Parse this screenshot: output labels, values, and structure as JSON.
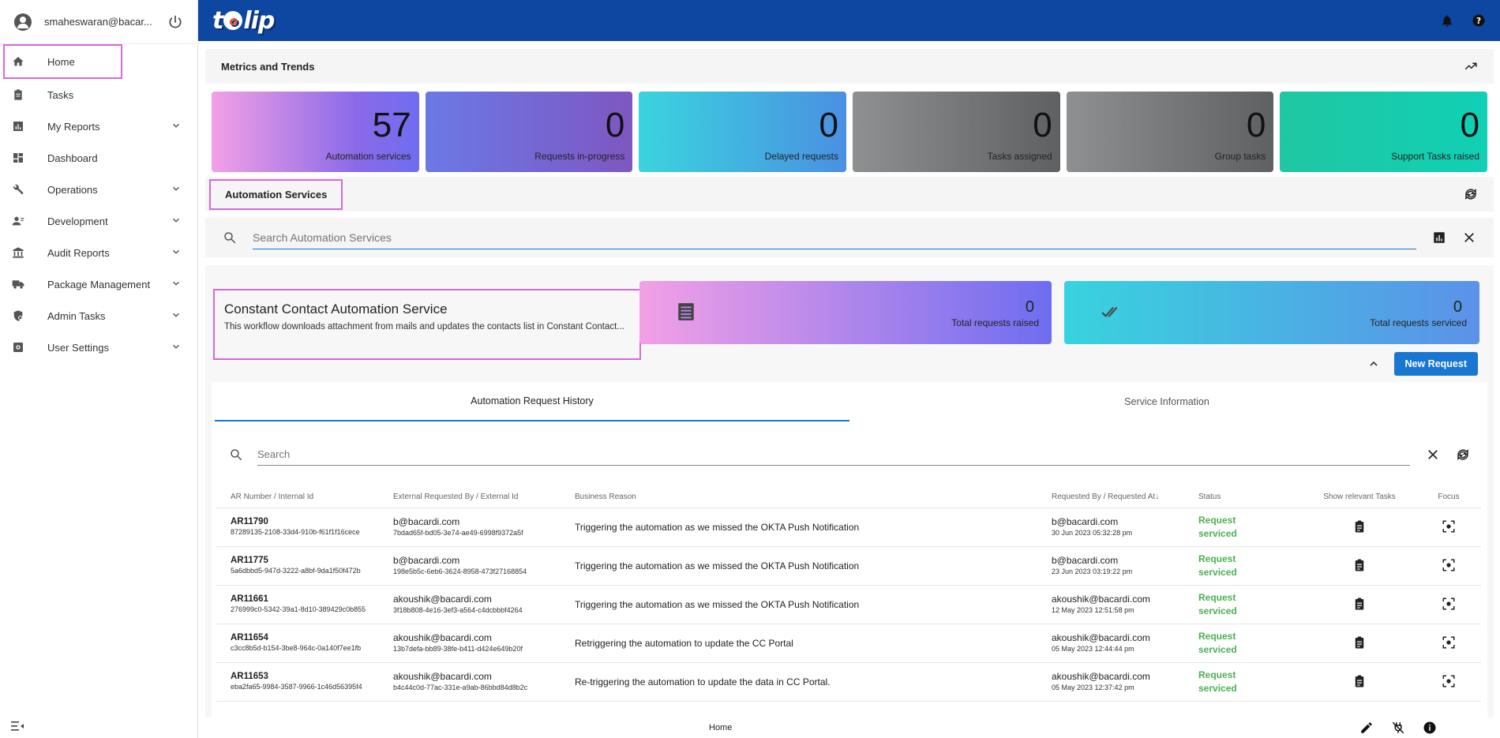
{
  "user": {
    "email": "smaheswaran@bacar..."
  },
  "nav": [
    {
      "label": "Home",
      "icon": "home-icon",
      "expandable": false
    },
    {
      "label": "Tasks",
      "icon": "clipboard-icon",
      "expandable": false
    },
    {
      "label": "My Reports",
      "icon": "report-icon",
      "expandable": true
    },
    {
      "label": "Dashboard",
      "icon": "dashboard-icon",
      "expandable": false
    },
    {
      "label": "Operations",
      "icon": "wrench-icon",
      "expandable": true
    },
    {
      "label": "Development",
      "icon": "developer-icon",
      "expandable": true
    },
    {
      "label": "Audit Reports",
      "icon": "bank-icon",
      "expandable": true
    },
    {
      "label": "Package Management",
      "icon": "truck-icon",
      "expandable": true
    },
    {
      "label": "Admin Tasks",
      "icon": "admin-icon",
      "expandable": true
    },
    {
      "label": "User Settings",
      "icon": "settings-box-icon",
      "expandable": true
    }
  ],
  "brand": {
    "logo_text_1": "t",
    "logo_o": "o",
    "logo_text_2": "lip",
    "topbar_color": "#0d47a1"
  },
  "metrics": {
    "title": "Metrics and Trends",
    "cards": [
      {
        "value": "57",
        "label": "Automation services"
      },
      {
        "value": "0",
        "label": "Requests in-progress"
      },
      {
        "value": "0",
        "label": "Delayed requests"
      },
      {
        "value": "0",
        "label": "Tasks assigned"
      },
      {
        "value": "0",
        "label": "Group tasks"
      },
      {
        "value": "0",
        "label": "Support Tasks raised"
      }
    ]
  },
  "automation": {
    "title": "Automation Services",
    "search_placeholder": "Search Automation Services"
  },
  "service": {
    "name": "Constant Contact Automation Service",
    "description": "This workflow downloads attachment from mails and updates the contacts list in Constant Contact...",
    "stats": [
      {
        "value": "0",
        "label": "Total requests raised"
      },
      {
        "value": "0",
        "label": "Total requests serviced"
      }
    ],
    "new_request_label": "New Request",
    "accent": "#1976d2"
  },
  "history": {
    "tabs": [
      "Automation Request History",
      "Service Information"
    ],
    "search_placeholder": "Search",
    "columns": [
      "AR Number / Internal Id",
      "External Requested By / External Id",
      "Business Reason",
      "Requested By / Requested At↓",
      "Status",
      "Show relevant Tasks",
      "Focus"
    ],
    "rows": [
      {
        "ar": "AR11790",
        "internal": "87289135-2108-33d4-910b-f61f1f16cece",
        "ext_by": "b@bacardi.com",
        "ext_id": "7bdad65f-bd05-3e74-ae49-6998f9372a5f",
        "reason": "Triggering the automation as we missed the OKTA Push Notification",
        "req_by": "b@bacardi.com",
        "req_at": "30 Jun 2023 05:32:28 pm",
        "status": "Request serviced"
      },
      {
        "ar": "AR11775",
        "internal": "5a6dbbd5-947d-3222-a8bf-9da1f50f472b",
        "ext_by": "b@bacardi.com",
        "ext_id": "198e5b5c-6eb6-3624-8958-473f27168854",
        "reason": "Triggering the automation as we missed the OKTA Push Notification",
        "req_by": "b@bacardi.com",
        "req_at": "23 Jun 2023 03:19:22 pm",
        "status": "Request serviced"
      },
      {
        "ar": "AR11661",
        "internal": "276999c0-5342-39a1-8d10-389429c0b855",
        "ext_by": "akoushik@bacardi.com",
        "ext_id": "3f18b808-4e16-3ef3-a564-c4dcbbbf4264",
        "reason": "Triggering the automation as we missed the OKTA Push Notification",
        "req_by": "akoushik@bacardi.com",
        "req_at": "12 May 2023 12:51:58 pm",
        "status": "Request serviced"
      },
      {
        "ar": "AR11654",
        "internal": "c3cc8b5d-b154-3be8-964c-0a140f7ee1fb",
        "ext_by": "akoushik@bacardi.com",
        "ext_id": "13b7defa-bb89-38fe-b411-d424e649b20f",
        "reason": "Retriggering the automation to update the CC Portal",
        "req_by": "akoushik@bacardi.com",
        "req_at": "05 May 2023 12:44:44 pm",
        "status": "Request serviced"
      },
      {
        "ar": "AR11653",
        "internal": "eba2fa65-9984-3587-9966-1c46d56395f4",
        "ext_by": "akoushik@bacardi.com",
        "ext_id": "b4c44c0d-77ac-331e-a9ab-86bbd84d8b2c",
        "reason": "Re-triggering the automation to update the data in CC Portal.",
        "req_by": "akoushik@bacardi.com",
        "req_at": "05 May 2023 12:37:42 pm",
        "status": "Request serviced"
      }
    ]
  },
  "footer": {
    "title": "Home"
  }
}
